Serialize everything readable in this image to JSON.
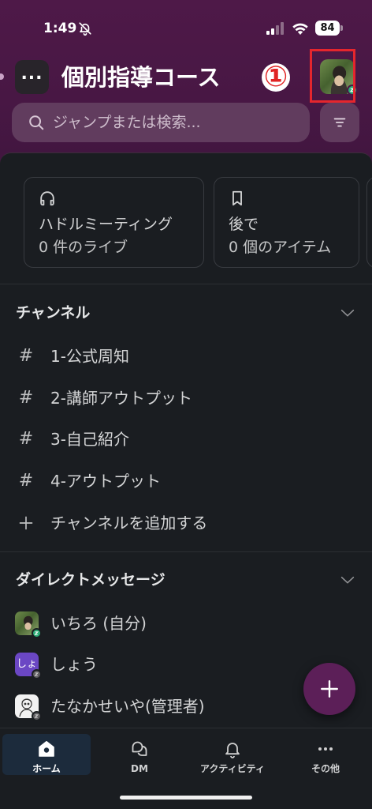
{
  "status_bar": {
    "time": "1:49",
    "battery": "84",
    "icons": [
      "bell-slash-icon",
      "signal-icon",
      "wifi-icon",
      "battery-icon"
    ]
  },
  "header": {
    "workspace_icon_text": "...",
    "title": "個別指導コース",
    "annotation_label": "①",
    "avatar": "user-avatar"
  },
  "search": {
    "placeholder": "ジャンプまたは検索...",
    "icon": "search-icon",
    "filter_icon": "filter-icon"
  },
  "cards": [
    {
      "icon": "headphones-icon",
      "title": "ハドルミーティング",
      "subtitle": "0 件のライブ"
    },
    {
      "icon": "bookmark-icon",
      "title": "後で",
      "subtitle": "0 個のアイテム"
    }
  ],
  "channels": {
    "header": "チャンネル",
    "items": [
      {
        "prefix": "#",
        "label": "1-公式周知"
      },
      {
        "prefix": "#",
        "label": "2-講師アウトプット"
      },
      {
        "prefix": "#",
        "label": "3-自己紹介"
      },
      {
        "prefix": "#",
        "label": "4-アウトプット"
      }
    ],
    "add_label": "チャンネルを追加する"
  },
  "dms": {
    "header": "ダイレクトメッセージ",
    "items": [
      {
        "label": "いちろ (自分)"
      },
      {
        "label": "しょう",
        "avatar_text": "しょ"
      },
      {
        "label": "たなかせいや(管理者)"
      }
    ]
  },
  "fab": {
    "icon": "plus-icon"
  },
  "tabs": [
    {
      "label": "ホーム",
      "icon": "home-icon",
      "selected": true
    },
    {
      "label": "DM",
      "icon": "dm-icon",
      "selected": false
    },
    {
      "label": "アクティビティ",
      "icon": "bell-icon",
      "selected": false
    },
    {
      "label": "その他",
      "icon": "more-icon",
      "selected": false
    }
  ],
  "colors": {
    "header_purple": "#4e1948",
    "panel_bg": "#1a1d21",
    "annotation_red": "#e5262d",
    "fab_purple": "#5c1f58",
    "selected_tab_bg": "#1c2b3c",
    "status_green": "#2bac76"
  }
}
